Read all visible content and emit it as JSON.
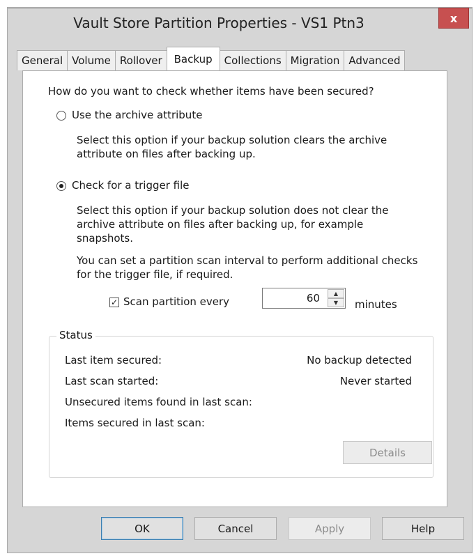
{
  "window": {
    "title": "Vault Store Partition Properties - VS1 Ptn3",
    "close_label": "x"
  },
  "tabs": [
    {
      "label": "General"
    },
    {
      "label": "Volume"
    },
    {
      "label": "Rollover"
    },
    {
      "label": "Backup",
      "active": true
    },
    {
      "label": "Collections"
    },
    {
      "label": "Migration"
    },
    {
      "label": "Advanced"
    }
  ],
  "backup": {
    "question": "How do you want to check whether items have been secured?",
    "option_archive": {
      "label": "Use the archive attribute",
      "selected": false,
      "description_line1": "Select this option if your backup solution clears the archive",
      "description_line2": "attribute on files after backing up."
    },
    "option_trigger": {
      "label": "Check for a trigger file",
      "selected": true,
      "description_line1": "Select this option if your backup solution does not clear the",
      "description_line2": "archive attribute on files after backing up, for example",
      "description_line3": "snapshots.",
      "interval_line1": "You can set a partition scan interval to perform additional checks",
      "interval_line2": "for the trigger file, if required."
    },
    "scan": {
      "checked": true,
      "check_mark": "✓",
      "label": "Scan partition every",
      "value": "60",
      "unit": "minutes",
      "up_glyph": "▲",
      "down_glyph": "▼"
    }
  },
  "status": {
    "group_label": "Status",
    "rows": [
      {
        "label": "Last item secured:",
        "value": "No backup detected"
      },
      {
        "label": "Last scan started:",
        "value": "Never started"
      },
      {
        "label": "Unsecured items found in last scan:",
        "value": ""
      },
      {
        "label": "Items secured in last scan:",
        "value": ""
      }
    ],
    "details_label": "Details"
  },
  "footer": {
    "ok": "OK",
    "cancel": "Cancel",
    "apply": "Apply",
    "help": "Help"
  }
}
